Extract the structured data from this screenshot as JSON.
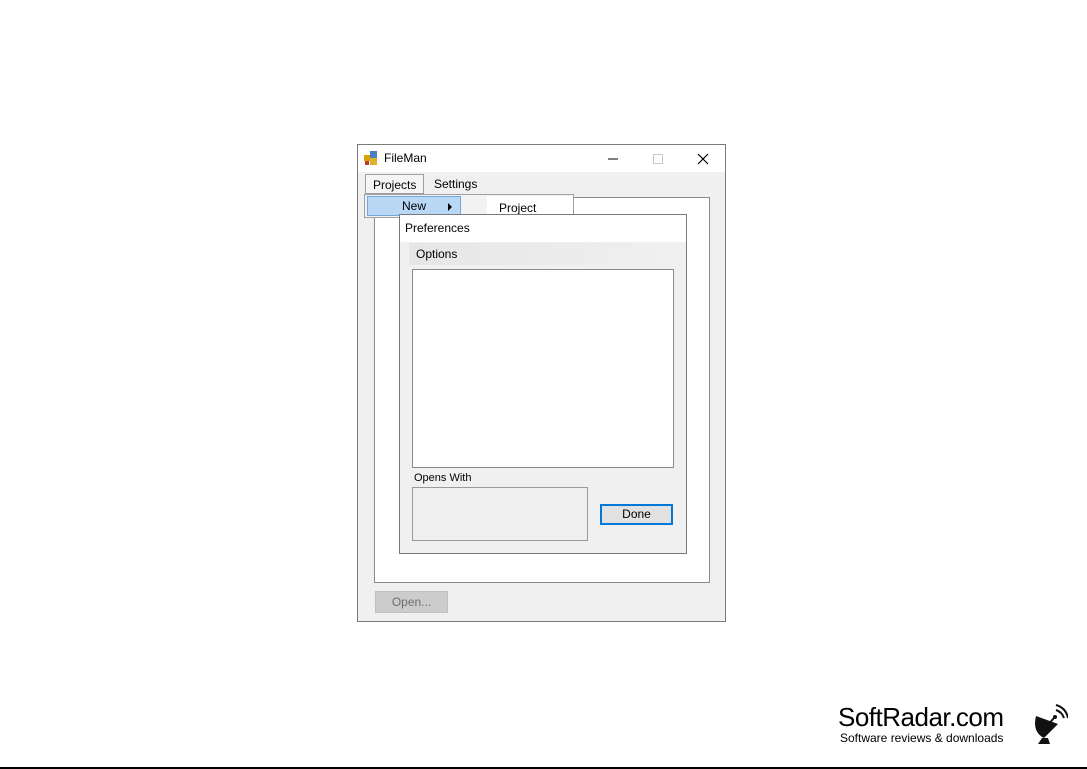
{
  "window": {
    "title": "FileMan",
    "app_icon": "app-grid-icon",
    "controls": {
      "minimize": "minimize-icon",
      "maximize": "maximize-icon",
      "close": "close-icon"
    }
  },
  "menubar": {
    "items": [
      {
        "label": "Projects"
      },
      {
        "label": "Settings"
      }
    ]
  },
  "dropdown": {
    "items": [
      {
        "label": "New",
        "has_submenu": true
      }
    ],
    "submenu": {
      "items": [
        {
          "label": "Project"
        }
      ]
    }
  },
  "main": {
    "open_button": "Open..."
  },
  "preferences": {
    "title": "Preferences",
    "tab_label": "Options",
    "opens_with_label": "Opens With",
    "done_button": "Done"
  },
  "watermark": {
    "brand": "SoftRadar.com",
    "tagline": "Software reviews & downloads",
    "icon": "satellite-dish-icon"
  },
  "colors": {
    "menu_highlight": "#b8d8f5",
    "focus_border": "#0078d7"
  }
}
